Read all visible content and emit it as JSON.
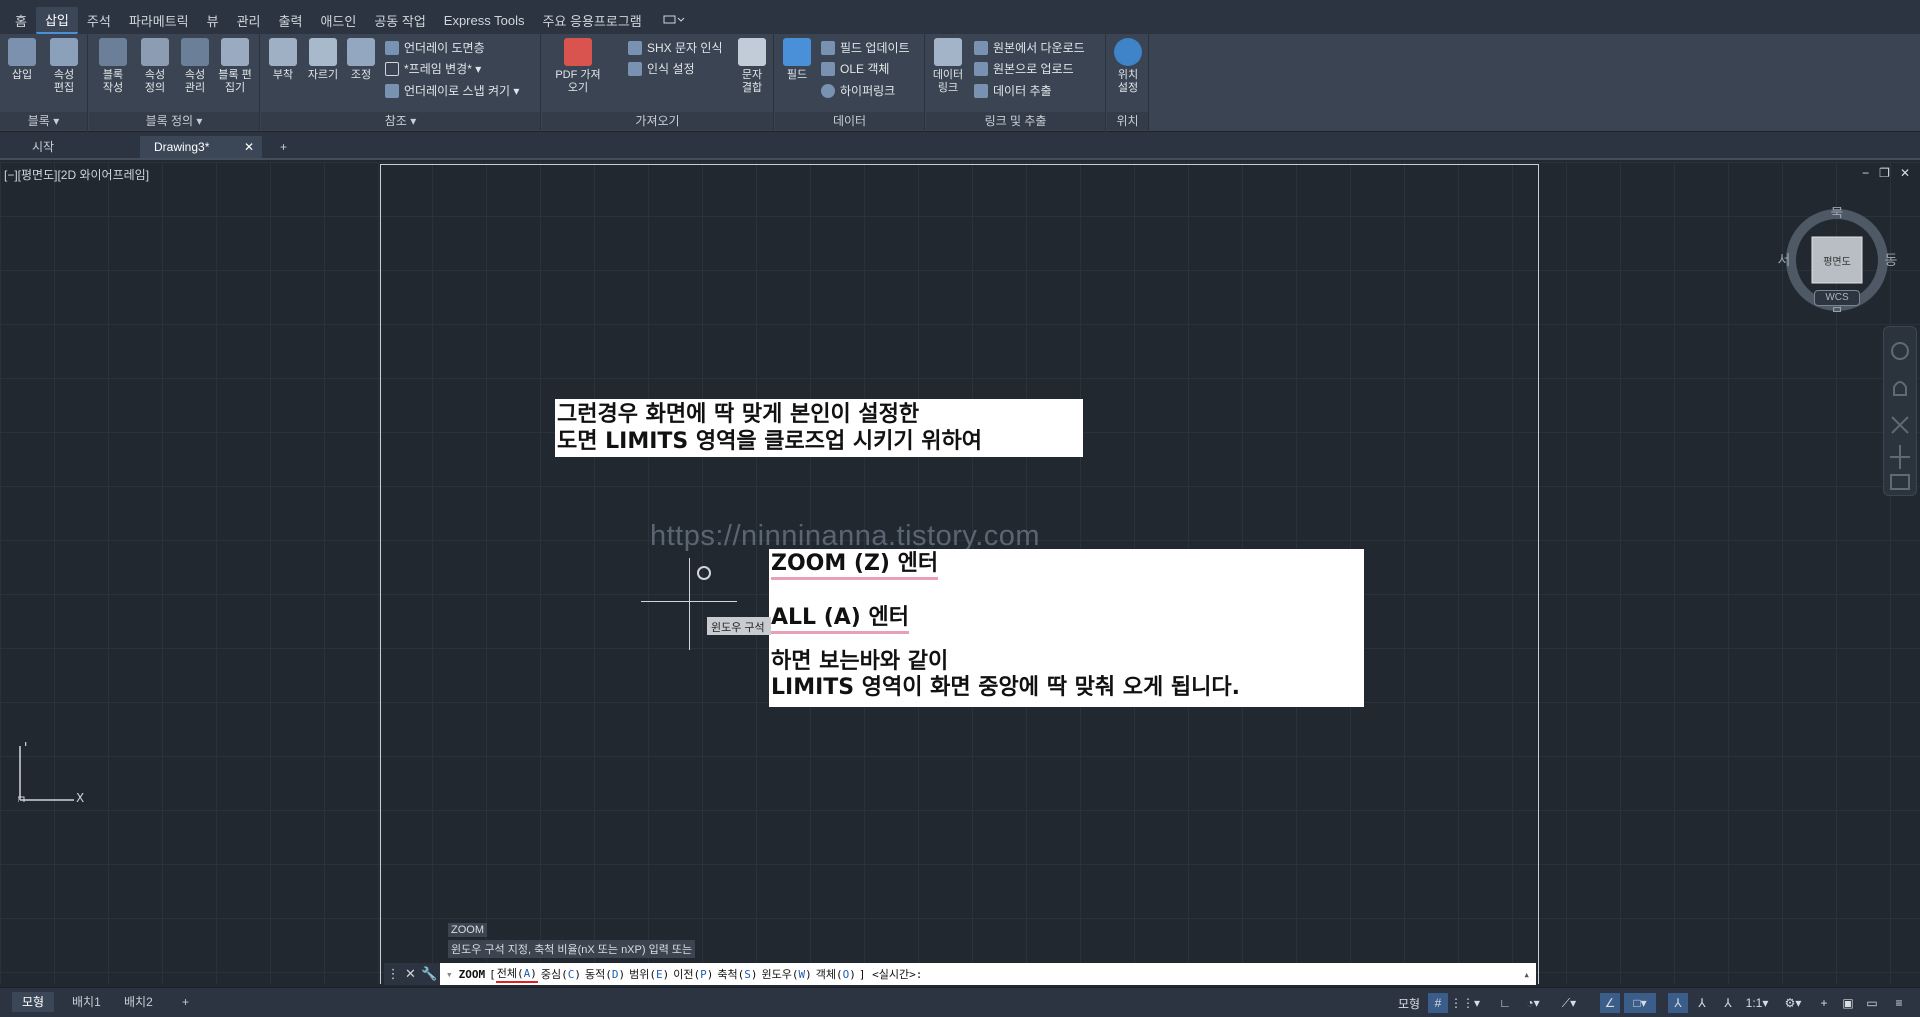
{
  "menu": {
    "items": [
      "홈",
      "삽입",
      "주석",
      "파라메트릭",
      "뷰",
      "관리",
      "출력",
      "애드인",
      "공동 작업",
      "Express Tools",
      "주요 응용프로그램"
    ],
    "active_index": 1
  },
  "ribbon": {
    "insert": {
      "label": "삽입"
    },
    "edit_attr": {
      "label": "속성 편집"
    },
    "create_block": {
      "label": "블록 작성"
    },
    "define_attr": {
      "label": "속성 정의"
    },
    "manage_attr": {
      "label": "속성 관리"
    },
    "block_editor": {
      "label": "블록 편집기"
    },
    "attach": {
      "label": "부착"
    },
    "clip": {
      "label": "자르기"
    },
    "adjust": {
      "label": "조정"
    },
    "underlay_layers": {
      "label": "언더레이 도면층"
    },
    "frames_vary": {
      "label": "*프레임 변경*"
    },
    "snap_underlay": {
      "label": "언더레이로 스냅 켜기"
    },
    "pdf_import": {
      "label": "PDF 가져오기"
    },
    "shx_recog": {
      "label": "SHX 문자 인식"
    },
    "recog_settings": {
      "label": "인식 설정"
    },
    "combine_text": {
      "label": "문자 결합"
    },
    "field": {
      "label": "필드"
    },
    "update_fields": {
      "label": "필드 업데이트"
    },
    "ole_object": {
      "label": "OLE 객체"
    },
    "hyperlink": {
      "label": "하이퍼링크"
    },
    "data_link": {
      "label": "데이터 링크"
    },
    "download_source": {
      "label": "원본에서 다운로드"
    },
    "upload_source": {
      "label": "원본으로 업로드"
    },
    "extract_data": {
      "label": "데이터 추출"
    },
    "set_location": {
      "label": "위치 설정"
    },
    "panels": {
      "block": "블록",
      "block_def": "블록 정의",
      "reference": "참조",
      "import": "가져오기",
      "data": "데이터",
      "link_extract": "링크 및 추출",
      "location": "위치"
    }
  },
  "file_tabs": {
    "start": "시작",
    "drawing": "Drawing3*",
    "close": "✕",
    "add": "+"
  },
  "viewport": {
    "label": "[−][평면도][2D 와이어프레임]",
    "controls": [
      "−",
      "❐",
      "✕"
    ]
  },
  "viewcube": {
    "north": "북",
    "south": "남",
    "east": "동",
    "west": "서",
    "face": "평면도",
    "wcs": "WCS"
  },
  "notes": {
    "box1": {
      "line1": "그런경우 화면에 딱 맞게 본인이 설정한",
      "line2": "도면 LIMITS 영역을 클로즈업 시키기 위하여"
    },
    "box2": {
      "line1": "ZOOM (Z) 엔터",
      "line2": "ALL (A) 엔터",
      "line3": "하면 보는바와 같이",
      "line4": "LIMITS 영역이 화면 중앙에  딱 맞춰 오게 됩니다."
    }
  },
  "watermark": "https://ninninanna.tistory.com",
  "tooltip": "윈도우 구석",
  "ucs": {
    "x": "X",
    "y": "Y"
  },
  "command": {
    "history1": "ZOOM",
    "history2": "윈도우 구석 지정, 축척 비율(nX 또는 nXP) 입력 또는",
    "name": "ZOOM",
    "options": [
      {
        "text": "전체",
        "key": "A"
      },
      {
        "text": "중심",
        "key": "C"
      },
      {
        "text": "동적",
        "key": "D"
      },
      {
        "text": "범위",
        "key": "E"
      },
      {
        "text": "이전",
        "key": "P"
      },
      {
        "text": "축척",
        "key": "S"
      },
      {
        "text": "윈도우",
        "key": "W"
      },
      {
        "text": "객체",
        "key": "O"
      }
    ],
    "default": "<실시간>:"
  },
  "layout_tabs": {
    "model": "모형",
    "layout1": "배치1",
    "layout2": "배치2",
    "add": "+"
  },
  "status": {
    "model": "모형",
    "scale": "1:1"
  }
}
